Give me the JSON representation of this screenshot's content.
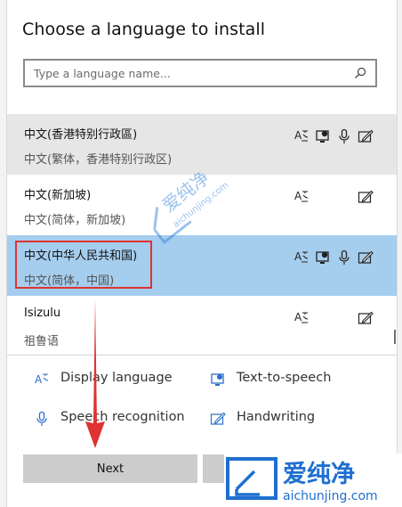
{
  "dialog": {
    "title": "Choose a language to install",
    "search_placeholder": "Type a language name..."
  },
  "languages": [
    {
      "name": "中文(香港特别行政區)",
      "sub": "中文(繁体，香港特别行政区)",
      "features": [
        "display-language",
        "text-to-speech",
        "speech-recognition",
        "handwriting"
      ],
      "state": "hover"
    },
    {
      "name": "中文(新加坡)",
      "sub": "中文(简体，新加坡)",
      "features": [
        "display-language",
        "handwriting"
      ],
      "state": "normal"
    },
    {
      "name": "中文(中华人民共和国)",
      "sub": "中文(简体，中国)",
      "features": [
        "display-language",
        "text-to-speech",
        "speech-recognition",
        "handwriting"
      ],
      "state": "selected"
    },
    {
      "name": "Isizulu",
      "sub": "祖鲁语",
      "features": [
        "display-language",
        "handwriting"
      ],
      "state": "normal"
    }
  ],
  "legend": {
    "display_language": "Display language",
    "text_to_speech": "Text-to-speech",
    "speech_recognition": "Speech recognition",
    "handwriting": "Handwriting"
  },
  "buttons": {
    "next": "Next",
    "cancel": ""
  },
  "watermark": {
    "center_cn": "爱纯净",
    "center_url": "aichunjing.com",
    "logo_cn": "爱纯净",
    "logo_url": "aichunjing.com"
  },
  "colors": {
    "selected_row": "#a5cdee",
    "hover_row": "#e6e6e6",
    "annotation_red": "#e03232",
    "watermark_blue": "#2a7ad8"
  }
}
